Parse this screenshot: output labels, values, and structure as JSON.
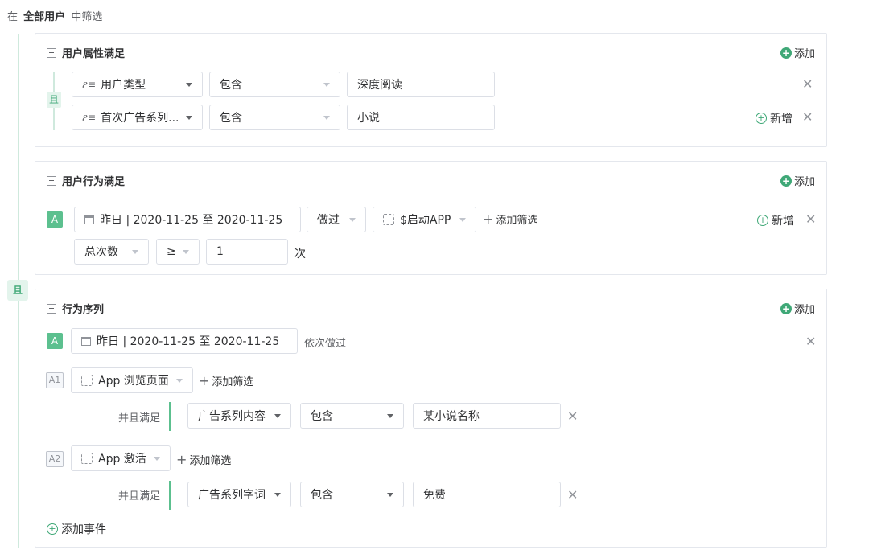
{
  "header": {
    "prefix": "在",
    "scope": "全部用户",
    "suffix": "中筛选"
  },
  "outer_logic": "且",
  "attr_panel": {
    "title": "用户属性满足",
    "add_label": "添加",
    "logic": "且",
    "rows": [
      {
        "field": "用户类型",
        "op": "包含",
        "value": "深度阅读"
      },
      {
        "field": "首次广告系列...",
        "op": "包含",
        "value": "小说",
        "new_label": "新增"
      }
    ]
  },
  "behavior_panel": {
    "title": "用户行为满足",
    "add_label": "添加",
    "badge": "A",
    "date": "昨日 | 2020-11-25 至 2020-11-25",
    "did": "做过",
    "event": "$启动APP",
    "add_filter": "添加筛选",
    "new_label": "新增",
    "metric": "总次数",
    "cmp": "≥",
    "count": "1",
    "unit": "次"
  },
  "seq_panel": {
    "title": "行为序列",
    "add_label": "添加",
    "badge": "A",
    "date": "昨日 | 2020-11-25 至 2020-11-25",
    "order_text": "依次做过",
    "steps": [
      {
        "badge": "A1",
        "event": "App 浏览页面",
        "add_filter": "添加筛选",
        "cond_label": "并且满足",
        "field": "广告系列内容",
        "op": "包含",
        "value": "某小说名称"
      },
      {
        "badge": "A2",
        "event": "App 激活",
        "add_filter": "添加筛选",
        "cond_label": "并且满足",
        "field": "广告系列字词",
        "op": "包含",
        "value": "免费"
      }
    ],
    "add_event": "添加事件"
  },
  "colors": {
    "accent": "#3fa877",
    "badge": "#5cc08f",
    "line": "#cfe9dd"
  }
}
